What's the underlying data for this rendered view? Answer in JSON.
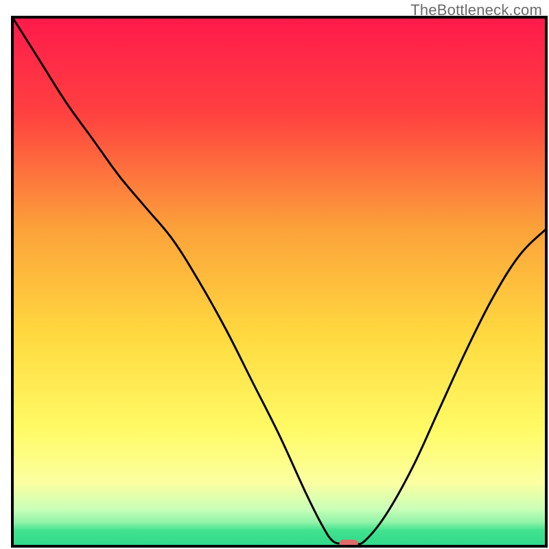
{
  "source_label": "TheBottleneck.com",
  "chart_data": {
    "type": "line",
    "title": "",
    "xlabel": "",
    "ylabel": "",
    "xlim": [
      0,
      100
    ],
    "ylim": [
      0,
      100
    ],
    "grid": false,
    "legend": false,
    "background": {
      "type": "vertical_gradient",
      "stops": [
        {
          "pos": 0.0,
          "color": "#ff1a4b"
        },
        {
          "pos": 0.18,
          "color": "#ff4040"
        },
        {
          "pos": 0.4,
          "color": "#fca23a"
        },
        {
          "pos": 0.6,
          "color": "#ffd93f"
        },
        {
          "pos": 0.78,
          "color": "#fffb66"
        },
        {
          "pos": 0.88,
          "color": "#fbffa1"
        },
        {
          "pos": 0.93,
          "color": "#caffb8"
        },
        {
          "pos": 0.955,
          "color": "#8ff3a8"
        },
        {
          "pos": 0.97,
          "color": "#42e28e"
        },
        {
          "pos": 1.0,
          "color": "#2fd98b"
        }
      ]
    },
    "series": [
      {
        "name": "bottleneck-curve",
        "color": "#000000",
        "stroke_width": 3,
        "x": [
          0,
          5,
          10,
          15,
          20,
          25,
          30,
          35,
          40,
          45,
          50,
          55,
          58,
          60,
          62,
          64,
          66,
          70,
          75,
          80,
          85,
          90,
          95,
          100
        ],
        "y": [
          100,
          92,
          84,
          77,
          70,
          64,
          58,
          50,
          41,
          31,
          21,
          10,
          4,
          1,
          0.5,
          0.5,
          1,
          6,
          15,
          26,
          37,
          47,
          55,
          60
        ]
      }
    ],
    "markers": [
      {
        "name": "optimal-point",
        "shape": "rounded-rect",
        "x": 63,
        "y": 0.5,
        "width_pct": 3.5,
        "height_pct": 1.5,
        "fill": "#dd6b6b"
      }
    ],
    "frame": {
      "color": "#000000",
      "stroke_width": 4
    }
  }
}
